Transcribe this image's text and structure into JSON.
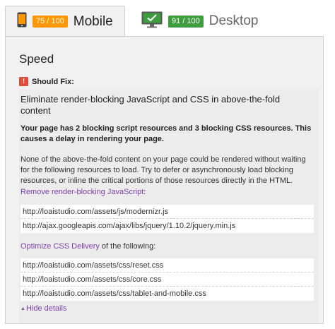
{
  "tabs": {
    "mobile": {
      "score": "75 / 100",
      "label": "Mobile",
      "score_color": "#ff9800",
      "icon": "mobile-phone-icon"
    },
    "desktop": {
      "score": "91 / 100",
      "label": "Desktop",
      "score_color": "#3e9e3e",
      "icon": "desktop-monitor-check-icon"
    }
  },
  "section": {
    "title": "Speed",
    "severity_label": "Should Fix:",
    "severity_icon": "warning-icon",
    "severity_glyph": "!"
  },
  "rule": {
    "heading": "Eliminate render-blocking JavaScript and CSS in above-the-fold content",
    "summary": "Your page has 2 blocking script resources and 3 blocking CSS resources. This causes a delay in rendering your page.",
    "description": "None of the above-the-fold content on your page could be rendered without waiting for the following resources to load. Try to defer or asynchronously load blocking resources, or inline the critical portions of those resources directly in the HTML.",
    "js_link": "Remove render-blocking JavaScript",
    "js_suffix": ":",
    "js_urls": [
      "http://loaistudio.com/assets/js/modernizr.js",
      "http://ajax.googleapis.com/ajax/libs/jquery/1.10.2/jquery.min.js"
    ],
    "css_link": "Optimize CSS Delivery",
    "css_suffix": " of the following:",
    "css_urls": [
      "http://loaistudio.com/assets/css/reset.css",
      "http://loaistudio.com/assets/css/core.css",
      "http://loaistudio.com/assets/css/tablet-and-mobile.css"
    ],
    "hide_details": "Hide details",
    "hide_glyph": "▲"
  }
}
